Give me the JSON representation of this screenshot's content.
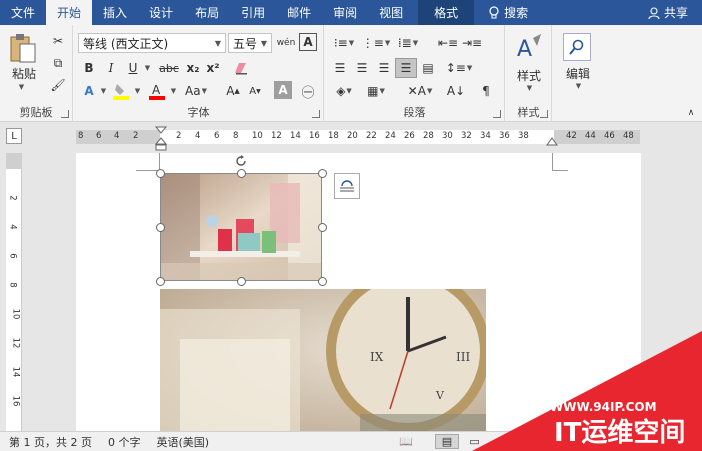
{
  "tabs": [
    "文件",
    "开始",
    "插入",
    "设计",
    "布局",
    "引用",
    "邮件",
    "审阅",
    "视图",
    "格式"
  ],
  "search": "搜索",
  "share": "共享",
  "ribbon": {
    "clipboard": {
      "paste": "粘贴",
      "label": "剪贴板"
    },
    "font": {
      "name": "等线 (西文正文)",
      "size": "五号",
      "wen": "wén",
      "label": "字体",
      "bold": "B",
      "italic": "I",
      "underline": "U",
      "strike": "abc",
      "sub": "x₂",
      "sup": "x²",
      "A": "A",
      "Aa": "Aa"
    },
    "paragraph": {
      "label": "段落"
    },
    "styles": {
      "label": "样式",
      "btn": "样式"
    },
    "editing": {
      "btn": "编辑"
    }
  },
  "ruler": {
    "corner": "L",
    "h_numbers": [
      "8",
      "6",
      "4",
      "2",
      "2",
      "4",
      "6",
      "8",
      "10",
      "12",
      "14",
      "16",
      "18",
      "20",
      "22",
      "24",
      "26",
      "28",
      "30",
      "32",
      "34",
      "36",
      "38",
      "42",
      "44",
      "46",
      "48"
    ],
    "v_numbers": [
      "2",
      "4",
      "6",
      "8",
      "10",
      "12",
      "14",
      "16"
    ]
  },
  "status": {
    "page": "第 1 页，共 2 页",
    "words": "0 个字",
    "lang": "英语(美国)"
  },
  "watermark": {
    "url": "WWW.94IP.COM",
    "name": "IT运维空间",
    "color": "#e8262f"
  },
  "colors": {
    "accent": "#2b579a",
    "highlight": "#ffff00",
    "font_red": "#ff0000"
  }
}
